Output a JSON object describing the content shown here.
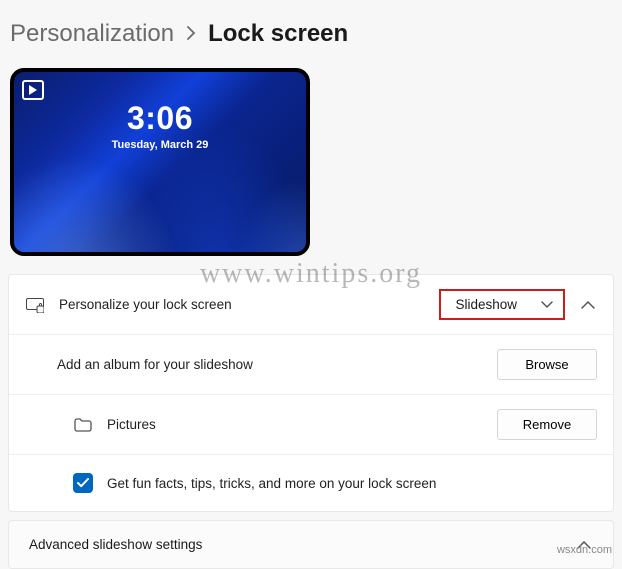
{
  "breadcrumb": {
    "parent": "Personalization",
    "current": "Lock screen"
  },
  "preview": {
    "time": "3:06",
    "date": "Tuesday, March 29"
  },
  "personalize": {
    "label": "Personalize your lock screen",
    "dropdown_value": "Slideshow"
  },
  "album": {
    "label": "Add an album for your slideshow",
    "button": "Browse"
  },
  "pictures": {
    "label": "Pictures",
    "button": "Remove"
  },
  "funfacts": {
    "label": "Get fun facts, tips, tricks, and more on your lock screen",
    "checked": true
  },
  "advanced": {
    "label": "Advanced slideshow settings"
  },
  "watermark": "www.wintips.org",
  "credit": "wsxdn.com"
}
